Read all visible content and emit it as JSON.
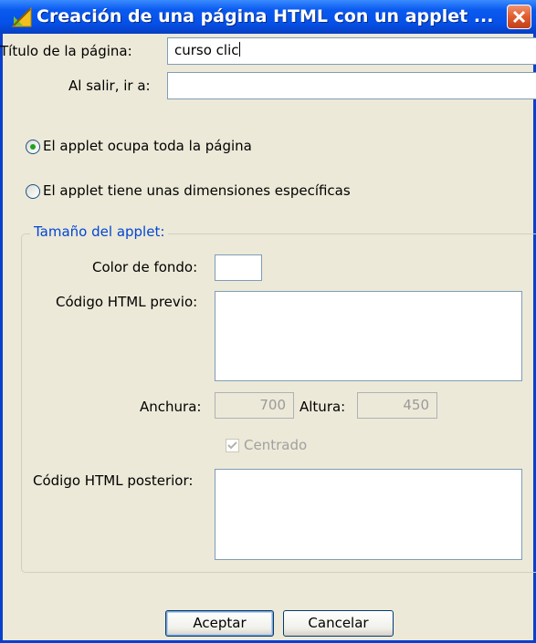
{
  "window": {
    "title": "Creación de una página HTML con un applet ...",
    "close_icon": "close-icon",
    "app_icon": "applet-icon"
  },
  "form": {
    "page_title_label": "Título de la página:",
    "page_title_value": "curso clic",
    "exit_label": "Al salir, ir a:",
    "exit_value": ""
  },
  "radios": [
    {
      "label": "El applet ocupa toda la página",
      "selected": true
    },
    {
      "label": "El applet tiene unas dimensiones específicas",
      "selected": false
    }
  ],
  "applet_size": {
    "legend": "Tamaño del applet:",
    "bg_color_label": "Color de fondo:",
    "bg_color_value": "#ffffff",
    "html_before_label": "Código HTML previo:",
    "html_before_value": "",
    "width_label": "Anchura:",
    "width_value": "700",
    "height_label": "Altura:",
    "height_value": "450",
    "centered_label": "Centrado",
    "centered_checked": true,
    "html_after_label": "Código HTML posterior:",
    "html_after_value": ""
  },
  "buttons": {
    "accept": "Aceptar",
    "cancel": "Cancelar"
  },
  "colors": {
    "titlebar": "#0550e8",
    "window_bg": "#ece9d8",
    "legend_text": "#0046d5",
    "radio_dot": "#21a121"
  }
}
